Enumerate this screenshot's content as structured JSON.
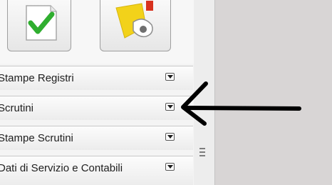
{
  "sidebar": {
    "shortcuts": [
      {
        "icon": "checkmark-document-icon"
      },
      {
        "icon": "whistle-icon"
      }
    ],
    "sections": [
      {
        "label": "Stampe Registri",
        "toggle_icon": "chevron-down-icon"
      },
      {
        "label": "Scrutini",
        "toggle_icon": "chevron-down-icon"
      },
      {
        "label": "Stampe Scrutini",
        "toggle_icon": "chevron-down-icon"
      },
      {
        "label": "Dati di Servizio e Contabili",
        "toggle_icon": "chevron-down-icon"
      }
    ]
  },
  "annotation": {
    "icon": "pointer-arrow-icon",
    "color": "#000000"
  },
  "colors": {
    "check": "#2fae2f",
    "whistle_yellow": "#f2d21a",
    "whistle_red": "#d8321e"
  }
}
